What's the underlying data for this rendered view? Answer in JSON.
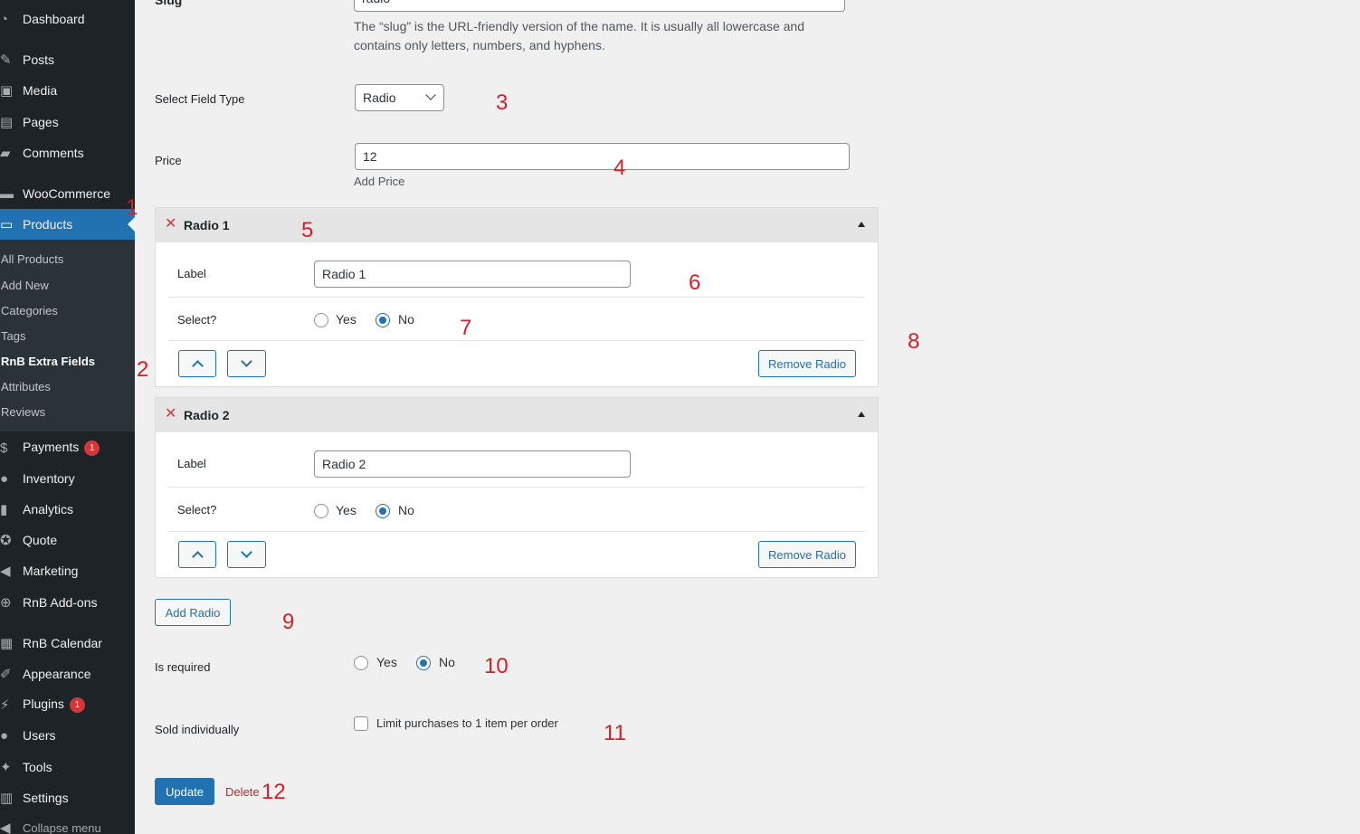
{
  "sidebar": {
    "menu": [
      {
        "label": "Dashboard",
        "icon": "dashboard-icon"
      },
      {
        "label": "Posts",
        "icon": "pin-icon"
      },
      {
        "label": "Media",
        "icon": "media-icon"
      },
      {
        "label": "Pages",
        "icon": "page-icon"
      },
      {
        "label": "Comments",
        "icon": "comment-icon"
      },
      {
        "label": "WooCommerce",
        "icon": "woo-icon"
      },
      {
        "label": "Products",
        "icon": "archive-icon"
      },
      {
        "label": "Payments",
        "icon": "dollar-icon",
        "badge": "1"
      },
      {
        "label": "Inventory",
        "icon": "groups-icon"
      },
      {
        "label": "Analytics",
        "icon": "chart-bar-icon"
      },
      {
        "label": "Quote",
        "icon": "award-icon"
      },
      {
        "label": "Marketing",
        "icon": "megaphone-icon"
      },
      {
        "label": "RnB Add-ons",
        "icon": "plus-circle-icon"
      },
      {
        "label": "RnB Calendar",
        "icon": "calendar-icon"
      },
      {
        "label": "Appearance",
        "icon": "brush-icon"
      },
      {
        "label": "Plugins",
        "icon": "plugin-icon",
        "badge": "1"
      },
      {
        "label": "Users",
        "icon": "users-icon"
      },
      {
        "label": "Tools",
        "icon": "wrench-icon"
      },
      {
        "label": "Settings",
        "icon": "settings-icon"
      }
    ],
    "submenu": [
      "All Products",
      "Add New",
      "Categories",
      "Tags",
      "RnB Extra Fields",
      "Attributes",
      "Reviews"
    ],
    "collapse_label": "Collapse menu"
  },
  "form": {
    "slug_label": "Slug",
    "slug_value": "radio",
    "slug_desc": "The “slug” is the URL-friendly version of the name. It is usually all lowercase and contains only letters, numbers, and hyphens.",
    "field_type_label": "Select Field Type",
    "field_type_value": "Radio",
    "price_label": "Price",
    "price_value": "12",
    "price_desc": "Add Price",
    "radios": [
      {
        "title": "Radio 1",
        "label_label": "Label",
        "label_value": "Radio 1",
        "select_label": "Select?",
        "yes": "Yes",
        "no": "No",
        "selected": "No",
        "remove": "Remove Radio"
      },
      {
        "title": "Radio 2",
        "label_label": "Label",
        "label_value": "Radio 2",
        "select_label": "Select?",
        "yes": "Yes",
        "no": "No",
        "selected": "No",
        "remove": "Remove Radio"
      }
    ],
    "add_radio": "Add Radio",
    "required_label": "Is required",
    "required_yes": "Yes",
    "required_no": "No",
    "required_selected": "No",
    "sold_label": "Sold individually",
    "sold_checkbox": "Limit purchases to 1 item per order",
    "update": "Update",
    "delete": "Delete"
  },
  "annotations": [
    "1",
    "2",
    "3",
    "4",
    "5",
    "6",
    "7",
    "8",
    "9",
    "10",
    "11",
    "12"
  ],
  "colors": {
    "sidebar_bg": "#1d2327",
    "accent": "#2271b1",
    "annotation": "#d61f26",
    "delete": "#b32d2e"
  }
}
